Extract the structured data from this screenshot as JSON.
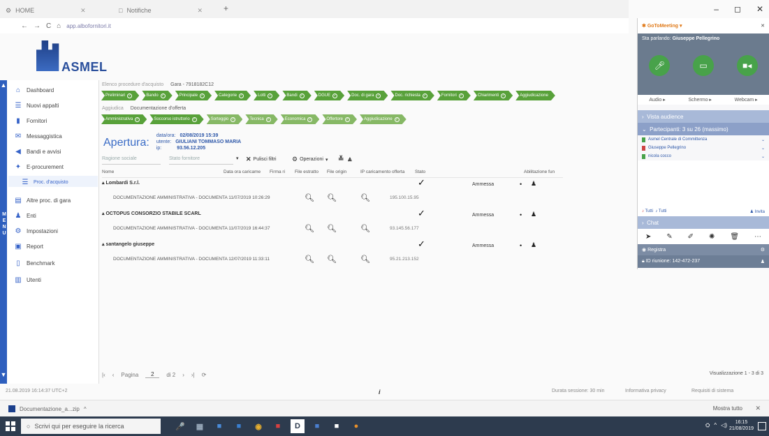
{
  "browser": {
    "tabs": [
      {
        "title": "HOME"
      },
      {
        "title": "Notifiche"
      }
    ],
    "new_tab": "+",
    "url": "app.albofornitori.it",
    "window_controls": [
      "–",
      "◻",
      "✕"
    ]
  },
  "logo": {
    "text": "ASMEL"
  },
  "menu": {
    "vertical_label": [
      "M",
      "E",
      "N",
      "U"
    ],
    "items": [
      {
        "label": "Dashboard",
        "icon": "home-icon"
      },
      {
        "label": "Nuovi appalti",
        "icon": "list-icon"
      },
      {
        "label": "Fornitori",
        "icon": "bars-icon"
      },
      {
        "label": "Messaggistica",
        "icon": "message-icon"
      },
      {
        "label": "Bandi e avvisi",
        "icon": "megaphone-icon"
      },
      {
        "label": "E-procurement",
        "icon": "procurement-icon"
      },
      {
        "label": "Proc. d'acquisto",
        "icon": "subitem-icon",
        "sub": true
      },
      {
        "label": "Altre proc. di gara",
        "icon": "folder-icon"
      },
      {
        "label": "Enti",
        "icon": "people-icon"
      },
      {
        "label": "Impostazioni",
        "icon": "gear-icon"
      },
      {
        "label": "Report",
        "icon": "report-icon"
      },
      {
        "label": "Benchmark",
        "icon": "document-icon"
      },
      {
        "label": "Utenti",
        "icon": "users-icon"
      }
    ]
  },
  "breadcrumb1": {
    "parent": "Elenco procedure d'acquisto",
    "current": "Gara - 7918182C12"
  },
  "steps1": [
    "Preliminari",
    "Bando",
    "Principale",
    "Categorie",
    "Lotti",
    "Bandi",
    "DGUE",
    "Doc. di gara",
    "Doc. richiesta",
    "Fornitori",
    "Chiarimenti",
    "Aggiudicazione"
  ],
  "breadcrumb2": {
    "parent": "Aggiudica",
    "current": "Documentazione d'offerta"
  },
  "steps2": [
    "Amministrativa",
    "Soccorso istruttorio",
    "Sorteggio",
    "Tecnica",
    "Economica",
    "Offertore",
    "Aggiudicazione"
  ],
  "opening": {
    "label": "Apertura:",
    "fields": [
      {
        "key": "data/ora:",
        "value": "02/08/2019 15:39"
      },
      {
        "key": "utente:",
        "value": "GIULIANI TOMMASO MARIA"
      },
      {
        "key": "ip:",
        "value": "93.56.12.205"
      }
    ]
  },
  "filters": {
    "search_placeholder": "Ragione sociale",
    "stato_placeholder": "Stato fornitore",
    "clear": "Pulisci filtri",
    "operations": "Operazioni"
  },
  "table": {
    "headers": [
      "Nome",
      "Data ora caricame",
      "Firma ri",
      "File estratto",
      "File origin",
      "IP caricamento offerta",
      "Stato",
      "Abilitazione fun"
    ],
    "groups": [
      {
        "name": "Lombardi S.r.l.",
        "stato": "Ammessa",
        "doc": "DOCUMENTAZIONE AMMINISTRATIVA - DOCUMENTA 11/07/2019 10:26:29",
        "ip": "195.100.15.95"
      },
      {
        "name": "OCTOPUS CONSORZIO STABILE SCARL",
        "stato": "Ammessa",
        "doc": "DOCUMENTAZIONE AMMINISTRATIVA - DOCUMENTA 11/07/2019 16:44:37",
        "ip": "93.145.56.177"
      },
      {
        "name": "santangelo giuseppe",
        "stato": "Ammessa",
        "doc": "DOCUMENTAZIONE AMMINISTRATIVA - DOCUMENTA 12/07/2019 11:33:11",
        "ip": "95.21.213.152"
      }
    ]
  },
  "pager": {
    "prefix": "Pagina",
    "page": "2",
    "of": "di 2",
    "first": "|‹",
    "prev": "‹",
    "next": "›",
    "last": "›|",
    "refresh": "⟳"
  },
  "viewing": "Visualizzazione 1 - 3 di 3",
  "footer": {
    "datetime": "21.08.2019 16:14:37 UTC+2",
    "info": "i",
    "session": "Durata sessione: 30 min",
    "privacy": "Informativa privacy",
    "requirements": "Requisiti di sistema"
  },
  "download": {
    "file": "Documentazione_a...zip",
    "show_all": "Mostra tutto",
    "close": "✕"
  },
  "taskbar": {
    "search": "Scrivi qui per eseguire la ricerca",
    "apps": [
      "🎤",
      "▦",
      "■",
      "■",
      "◉",
      "■",
      "D",
      "■",
      "■",
      "●"
    ],
    "time": "16:15",
    "date": "21/08/2019"
  },
  "gtm": {
    "brand": "GoToMeeting",
    "close": "✕",
    "presenter_label": "Sta parlando:",
    "presenter": "Giuseppe Pellegrino",
    "sub": [
      "Audio ▸",
      "Schermo ▸",
      "Webcam ▸"
    ],
    "audience": "Vista audience",
    "participants": "Partecipanti: 3 su 26 (massimo)",
    "people": [
      "Asmel Centrale di Committenza",
      "Giuseppe Pellegrino",
      "nicola cocco"
    ],
    "mute_all": "Tutti",
    "unmute_all": "Tutti",
    "invite": "Invita",
    "chat": "Chat",
    "record": "Registra",
    "meeting_id": "ID riunione: 142-472-237"
  },
  "colors": {
    "step_green": "#58a13a",
    "menu_blue": "#2e5fbe",
    "accent": "#3a6cc6"
  }
}
